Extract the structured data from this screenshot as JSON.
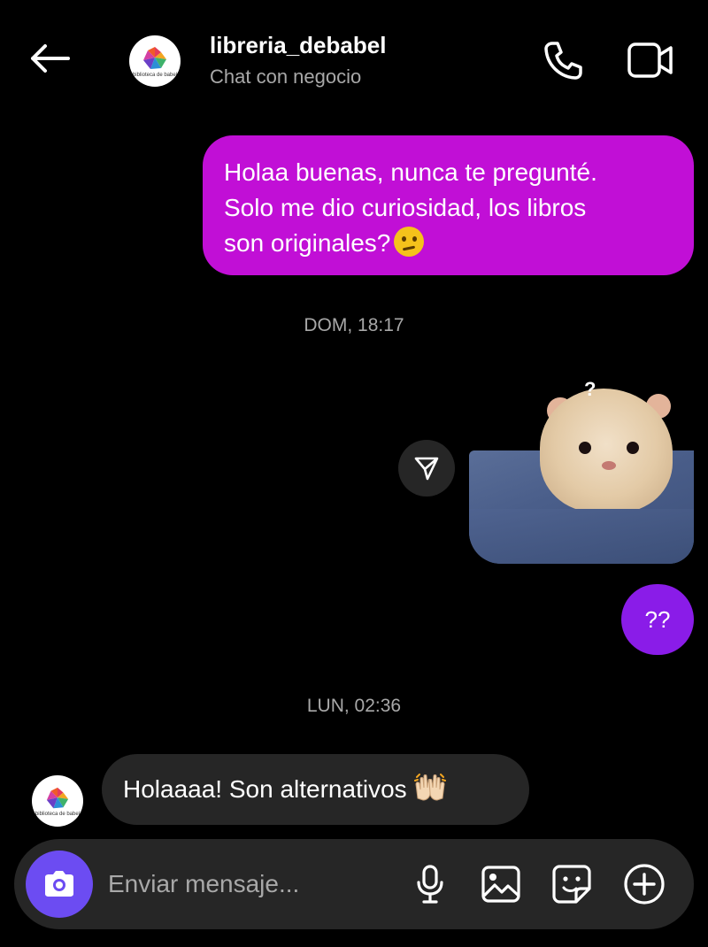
{
  "header": {
    "title": "libreria_debabel",
    "subtitle": "Chat con negocio",
    "avatar_text": "biblioteca de babel"
  },
  "messages": {
    "out1_line1": "Holaa buenas, nunca te pregunté.",
    "out1_line2": "Solo me dio curiosidad, los libros",
    "out1_line3": "son originales?",
    "out1_emoji": "thinking-face",
    "ts1": "DOM, 18:17",
    "sticker_caption": "?",
    "out2": "??",
    "ts2": "LUN, 02:36",
    "in1": "Holaaaa! Son alternativos",
    "in1_emoji": "raising-hands"
  },
  "composer": {
    "placeholder": "Enviar mensaje..."
  },
  "colors": {
    "background": "#000000",
    "outgoing_bubble": "#c10fd6",
    "outgoing_bubble_alt": "#8a1ce8",
    "incoming_bubble": "#262626",
    "camera_button": "#6c4cf2",
    "muted_text": "#a8a8a8"
  }
}
